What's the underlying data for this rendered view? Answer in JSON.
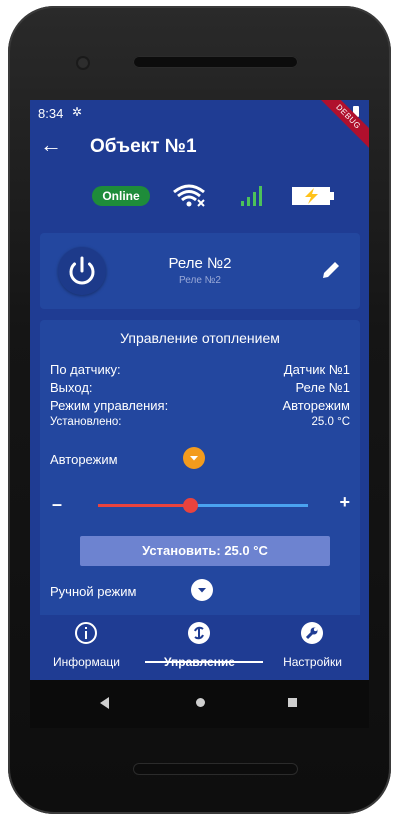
{
  "status_bar": {
    "time": "8:34",
    "gear": "✲",
    "debug": "DEBUG"
  },
  "app_bar": {
    "back": "←",
    "title": "Объект №1"
  },
  "indicators": {
    "online": "Online"
  },
  "relay": {
    "name": "Реле №2",
    "subtitle": "Реле №2"
  },
  "control": {
    "title": "Управление отоплением",
    "rows": [
      {
        "label": "По датчику:",
        "value": "Датчик №1"
      },
      {
        "label": "Выход:",
        "value": "Реле №1"
      },
      {
        "label": "Режим управления:",
        "value": "Авторежим"
      },
      {
        "label": "Установлено:",
        "value": "25.0 °C"
      }
    ],
    "auto_mode_label": "Авторежим",
    "minus": "–",
    "plus": "+",
    "slider_fraction": 0.44,
    "set_button": "Установить: 25.0 °C",
    "manual_mode_label": "Ручной режим"
  },
  "bottom_nav": {
    "items": [
      {
        "label": "Информаци",
        "icon": "info-icon"
      },
      {
        "label": "Управление",
        "icon": "control-icon"
      },
      {
        "label": "Настройки",
        "icon": "settings-icon"
      }
    ],
    "active_index": 1
  },
  "colors": {
    "screen_bg": "#1f3c93",
    "card_bg": "#23479f",
    "online_green": "#1e8c3a",
    "slider_red": "#e9433e",
    "slider_blue": "#4aa3f0",
    "battery_yellow": "#ffc21a",
    "auto_orange": "#f39b1d"
  }
}
